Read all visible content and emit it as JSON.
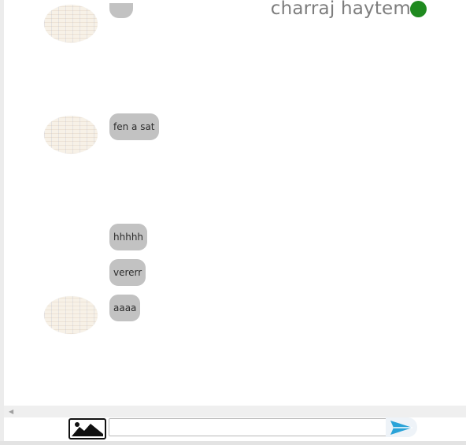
{
  "header": {
    "contact_name": "charraj haytem",
    "status_color": "#1f8a1f"
  },
  "messages": [
    {
      "text": "",
      "has_avatar": true
    },
    {
      "text": "fen a sat",
      "has_avatar": true
    },
    {
      "text": "hhhhh",
      "has_avatar": false
    },
    {
      "text": "vererr",
      "has_avatar": false
    },
    {
      "text": "aaaa",
      "has_avatar": true
    }
  ],
  "composer": {
    "message_value": "",
    "image_icon": "image-icon",
    "send_icon": "send-icon",
    "send_color": "#2aa3d8"
  }
}
